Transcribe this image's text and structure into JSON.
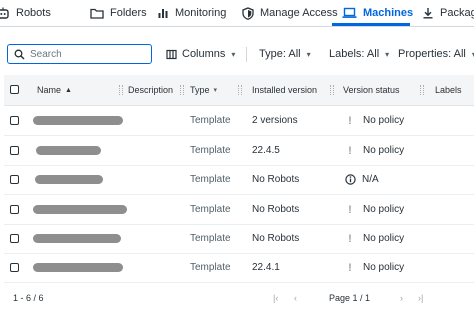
{
  "tabs": {
    "robots": "Robots",
    "folders": "Folders",
    "monitoring": "Monitoring",
    "manage_access": "Manage Access",
    "machines": "Machines",
    "packages": "Packages"
  },
  "toolbar": {
    "search_placeholder": "Search",
    "columns": "Columns",
    "type_filter": "Type: All",
    "labels_filter": "Labels: All",
    "properties_filter": "Properties: All"
  },
  "table": {
    "headers": {
      "name": "Name",
      "description": "Description",
      "type": "Type",
      "installed_version": "Installed version",
      "version_status": "Version status",
      "labels": "Labels"
    },
    "rows": [
      {
        "type": "Template",
        "installed_version": "2 versions",
        "version_status": "No policy",
        "status_icon": "exclamation-icon"
      },
      {
        "type": "Template",
        "installed_version": "22.4.5",
        "version_status": "No policy",
        "status_icon": "exclamation-icon"
      },
      {
        "type": "Template",
        "installed_version": "No Robots",
        "version_status": "N/A",
        "status_icon": "info-icon"
      },
      {
        "type": "Template",
        "installed_version": "No Robots",
        "version_status": "No policy",
        "status_icon": "exclamation-icon"
      },
      {
        "type": "Template",
        "installed_version": "No Robots",
        "version_status": "No policy",
        "status_icon": "exclamation-icon"
      },
      {
        "type": "Template",
        "installed_version": "22.4.1",
        "version_status": "No policy",
        "status_icon": "exclamation-icon"
      }
    ]
  },
  "pager": {
    "range": "1 - 6 / 6",
    "page": "Page 1 / 1"
  },
  "colors": {
    "accent": "#0067df",
    "text": "#273139",
    "header_bg": "#f4f5f7"
  }
}
